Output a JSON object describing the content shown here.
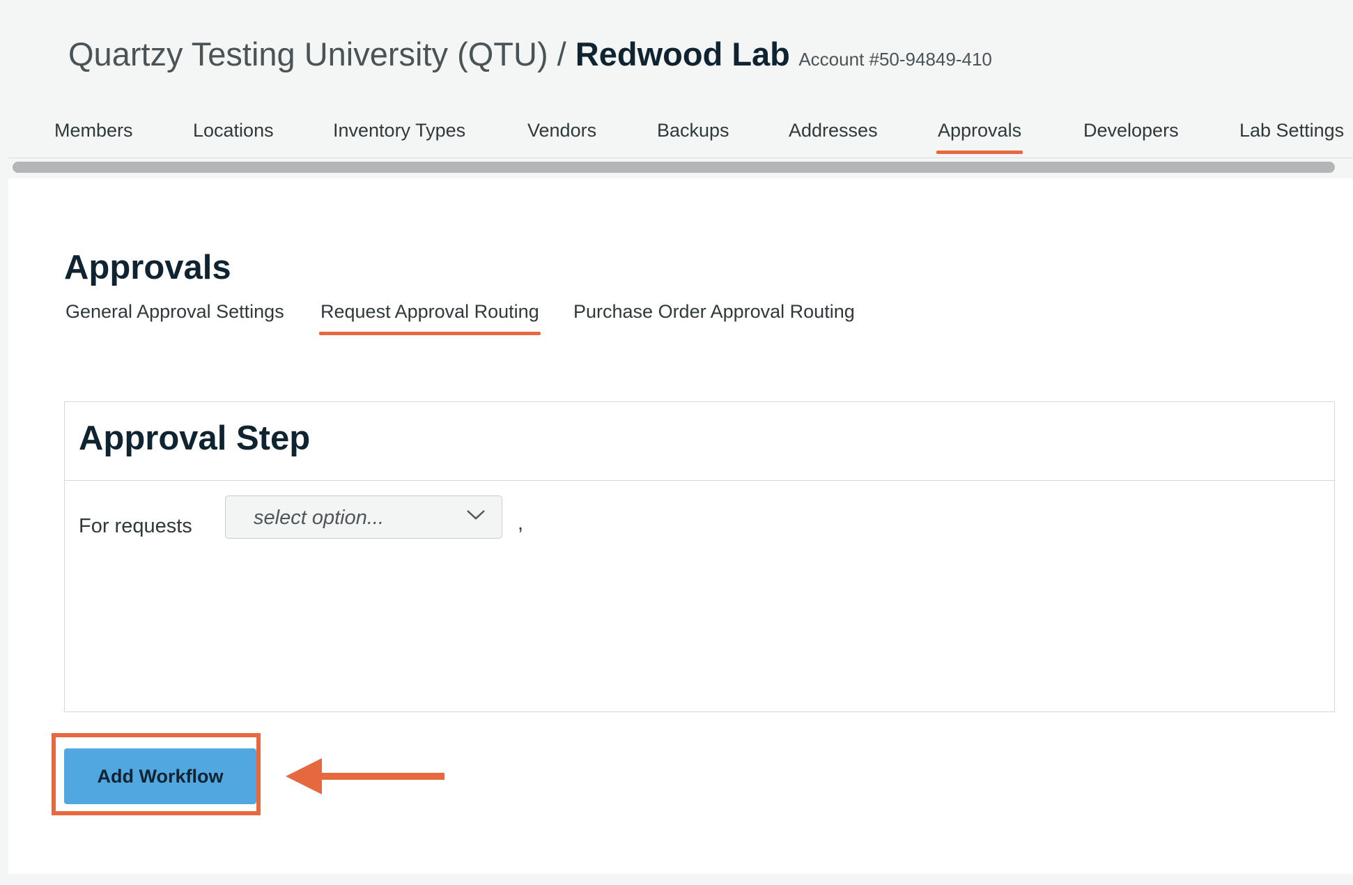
{
  "header": {
    "org_name": "Quartzy Testing University (QTU) / ",
    "lab_name": "Redwood Lab",
    "account": "Account #50-94849-410"
  },
  "nav": {
    "items": [
      {
        "label": "Members"
      },
      {
        "label": "Locations"
      },
      {
        "label": "Inventory Types"
      },
      {
        "label": "Vendors"
      },
      {
        "label": "Backups"
      },
      {
        "label": "Addresses"
      },
      {
        "label": "Approvals",
        "active": true
      },
      {
        "label": "Developers"
      },
      {
        "label": "Lab Settings"
      }
    ]
  },
  "main": {
    "title": "Approvals",
    "subtabs": [
      {
        "label": "General Approval Settings"
      },
      {
        "label": "Request Approval Routing",
        "active": true
      },
      {
        "label": "Purchase Order Approval Routing"
      }
    ],
    "step": {
      "title": "Approval Step",
      "for_requests_label": "For requests",
      "select_placeholder": "select option...",
      "trailing_comma": ","
    },
    "add_workflow_label": "Add Workflow"
  },
  "colors": {
    "accent": "#e5683e",
    "button": "#51a7df",
    "background": "#f4f5f5"
  },
  "icons": {
    "select_icon": "chevron-down-icon",
    "annotation_icon": "arrow-left-icon"
  }
}
